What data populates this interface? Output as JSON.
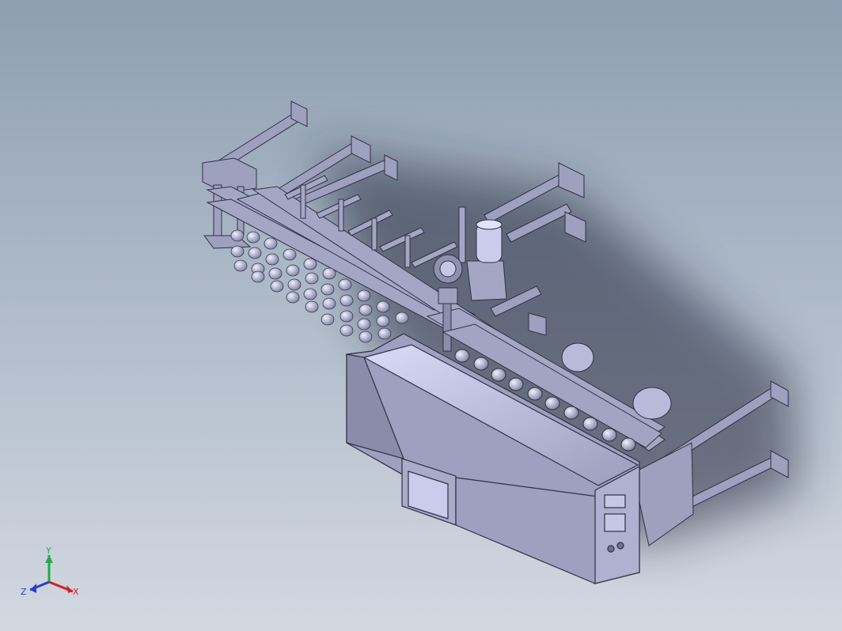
{
  "window": {
    "title": "",
    "background_top": "#8f9eb2",
    "background_bottom": "#d3d8e1"
  },
  "model": {
    "frame_color": "#9ea1bd",
    "outline_color": "#303044",
    "cabinet_highlight": "#cfd3f0",
    "shadow_color": "#282c38"
  },
  "triad": {
    "x_label": "X",
    "y_label": "Y",
    "z_label": "Z",
    "x_color": "#d42020",
    "y_color": "#22a84a",
    "z_color": "#2a3cd0"
  }
}
